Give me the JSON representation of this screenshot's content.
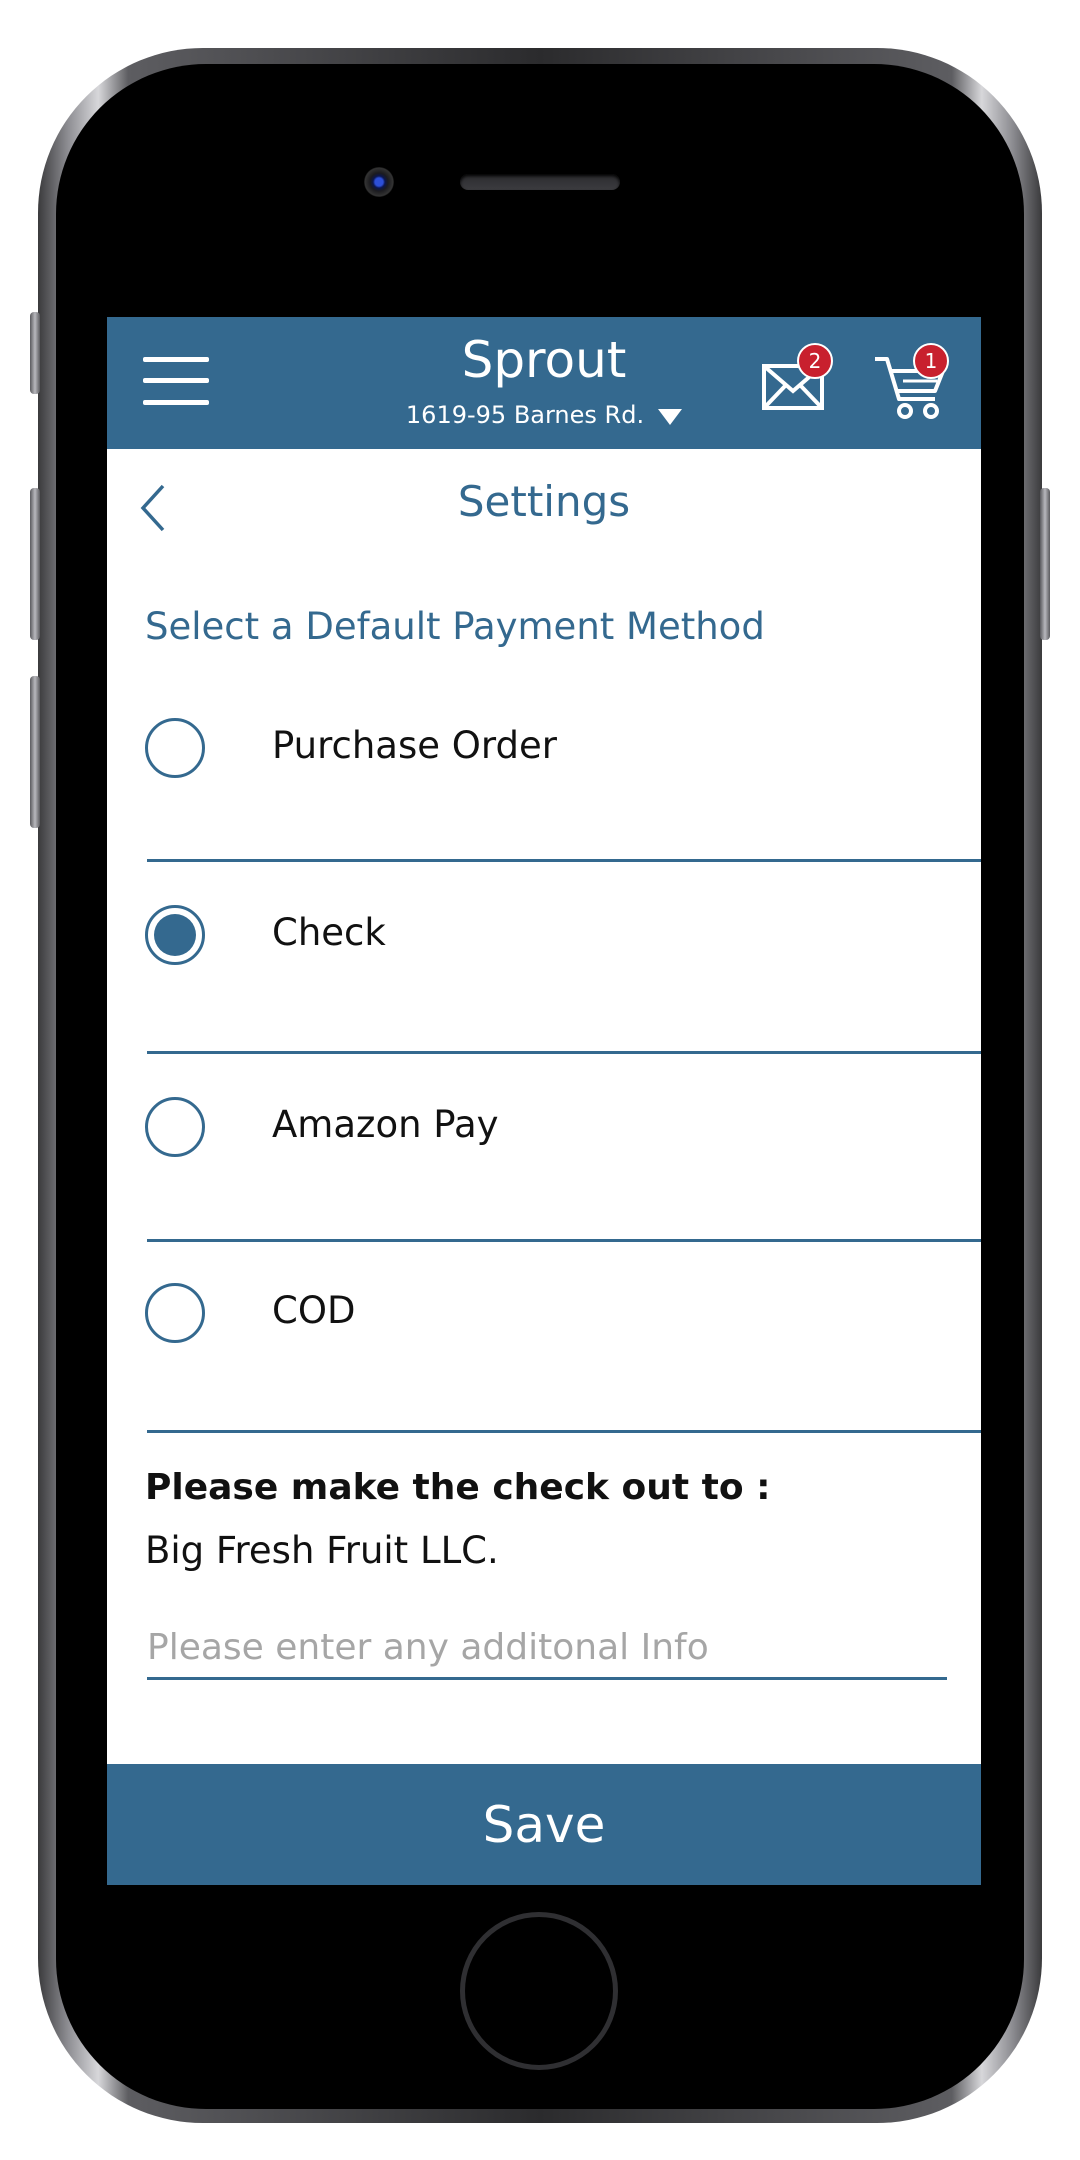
{
  "header": {
    "app_title": "Sprout",
    "location": "1619-95 Barnes Rd.",
    "messages_badge": "2",
    "cart_badge": "1"
  },
  "page": {
    "title": "Settings"
  },
  "payment": {
    "section_title": "Select a Default Payment Method",
    "options": [
      {
        "label": "Purchase Order",
        "selected": false
      },
      {
        "label": "Check",
        "selected": true
      },
      {
        "label": "Amazon Pay",
        "selected": false
      },
      {
        "label": "COD",
        "selected": false
      }
    ]
  },
  "check_info": {
    "heading": "Please make the check out to :",
    "payee": "Big Fresh Fruit LLC.",
    "input_value": "",
    "input_placeholder": "Please enter any additonal Info"
  },
  "actions": {
    "save_label": "Save"
  },
  "colors": {
    "primary": "#34698f",
    "badge": "#c8202e"
  },
  "icons": {
    "menu": "hamburger-icon",
    "messages": "mail-icon",
    "cart": "cart-icon",
    "back": "chevron-left-icon",
    "location_dropdown": "caret-down-icon"
  }
}
